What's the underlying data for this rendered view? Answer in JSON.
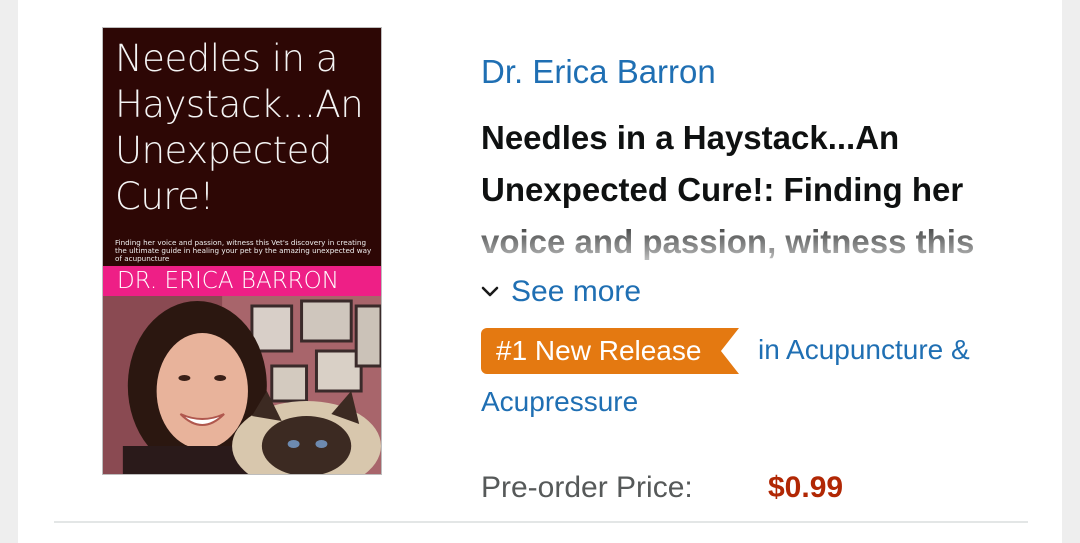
{
  "book": {
    "author": "Dr. Erica Barron",
    "title": "Needles in a Haystack...An Unexpected Cure!: Finding her voice and passion, witness this Vet's discovery in creating the ultimate guide in healing your pet by the amazing unexpected way of acupuncture",
    "see_more_label": "See more"
  },
  "cover": {
    "title": "Needles in a\nHaystack...An\nUnexpected\nCure!",
    "subtitle": "Finding her voice and passion, witness this Vet's discovery in creating the ultimate guide in healing your pet by the amazing unexpected way of acupuncture",
    "author": "DR. ERICA BARRON",
    "background_color": "#2d0705",
    "band_color": "#ee1f86"
  },
  "badge": {
    "label": "#1 New Release",
    "color": "#e47911"
  },
  "category": {
    "line1": "in Acupuncture &",
    "line2": "Acupressure"
  },
  "price": {
    "label": "Pre-order Price:",
    "value": "$0.99",
    "value_color": "#b12704"
  },
  "icons": {
    "see_more": "chevron-down-icon"
  },
  "colors": {
    "link": "#1f6fb3",
    "title_text": "#0f1111"
  }
}
